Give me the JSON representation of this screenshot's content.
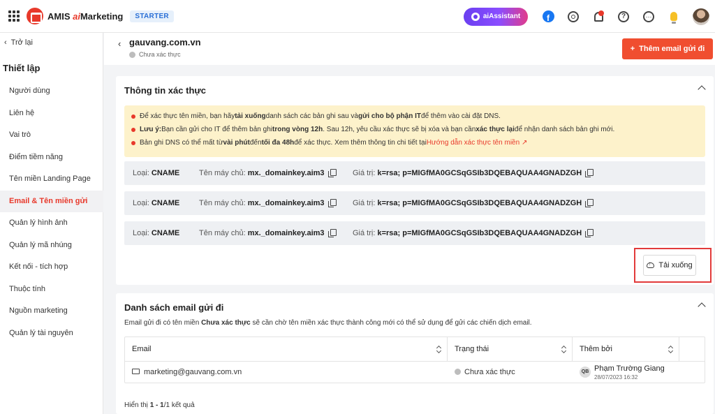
{
  "topbar": {
    "brand_prefix": "AMIS ",
    "brand_ai": "ai",
    "brand_suffix": "Marketing",
    "plan": "STARTER",
    "ai_assistant": "aiAssistant",
    "fb_glyph": "f",
    "help_glyph": "?",
    "more_glyph": "···",
    "icons": [
      "apps-grid-icon",
      "facebook-icon",
      "gear-icon",
      "bell-icon",
      "help-icon",
      "more-icon",
      "lightbulb-icon",
      "user-avatar"
    ],
    "colors": {
      "brand": "#e8392b",
      "plan_badge": "#2a6fd6"
    }
  },
  "sidebar": {
    "back": "Trở lại",
    "back_glyph": "‹",
    "title": "Thiết lập",
    "items": [
      {
        "label": "Người dùng"
      },
      {
        "label": "Liên hệ"
      },
      {
        "label": "Vai trò"
      },
      {
        "label": "Điểm tiềm năng"
      },
      {
        "label": "Tên miền Landing Page"
      },
      {
        "label": "Email & Tên miền gửi"
      },
      {
        "label": "Quản lý hình ảnh"
      },
      {
        "label": "Quản lý mã nhúng"
      },
      {
        "label": "Kết nối - tích hợp"
      },
      {
        "label": "Thuộc tính"
      },
      {
        "label": "Nguồn marketing"
      },
      {
        "label": "Quản lý tài nguyên"
      }
    ],
    "active_index": 5
  },
  "header": {
    "back_glyph": "‹",
    "domain": "gauvang.com.vn",
    "status": "Chưa xác thực",
    "add_button_icon": "+",
    "add_button": "Thêm email gửi đi",
    "add_button_color": "#f04e30"
  },
  "verify": {
    "title": "Thông tin xác thực",
    "notice": {
      "l1_a": "Để xác thực tên miền, bạn hãy ",
      "l1_b": "tải xuống",
      "l1_c": " danh sách các bản ghi sau và ",
      "l1_d": "gửi cho bộ phận IT",
      "l1_e": " để thêm vào cài đặt DNS.",
      "l2_a": "Lưu ý:",
      "l2_b": " Bạn cần gửi cho IT để thêm bản ghi ",
      "l2_c": "trong vòng 12h",
      "l2_d": ". Sau 12h, yêu cầu xác thực sẽ bị xóa và bạn cần ",
      "l2_e": "xác thực lại",
      "l2_f": " để nhận danh sách bản ghi mới.",
      "l3_a": "Bản ghi DNS có thể mất từ ",
      "l3_b": "vài phút",
      "l3_c": " đến ",
      "l3_d": "tối đa 48h",
      "l3_e": " để xác thực. Xem thêm thông tin chi tiết tại ",
      "l3_link": "Hướng dẫn xác thực tên miền",
      "l3_link_icon": "↗"
    },
    "records": [
      {
        "type_label": "Loại:",
        "type": "CNAME",
        "host_label": "Tên máy chủ:",
        "host": "mx._domainkey.aim3",
        "value_label": "Giá trị:",
        "value": "k=rsa; p=MIGfMA0GCSqGSIb3DQEBAQUAA4GNADZGH"
      },
      {
        "type_label": "Loại:",
        "type": "CNAME",
        "host_label": "Tên máy chủ:",
        "host": "mx._domainkey.aim3",
        "value_label": "Giá trị:",
        "value": "k=rsa; p=MIGfMA0GCSqGSIb3DQEBAQUAA4GNADZGH"
      },
      {
        "type_label": "Loại:",
        "type": "CNAME",
        "host_label": "Tên máy chủ:",
        "host": "mx._domainkey.aim3",
        "value_label": "Giá trị:",
        "value": "k=rsa; p=MIGfMA0GCSqGSIb3DQEBAQUAA4GNADZGH"
      }
    ],
    "download": "Tải xuống"
  },
  "senders": {
    "title": "Danh sách email gửi đi",
    "desc_a": "Email gửi đi có tên miền ",
    "desc_b": "Chưa xác thực",
    "desc_c": " sẽ cần chờ tên miền xác thực thành công mới có thể sử dụng để gửi các chiến dịch email.",
    "columns": [
      "Email",
      "Trạng thái",
      "Thêm bởi"
    ],
    "rows": [
      {
        "email": "marketing@gauvang.com.vn",
        "status": "Chưa xác thực",
        "avatar": "QB",
        "name": "Phạm Trường Giang",
        "date": "28/07/2023 16:32"
      }
    ],
    "footer_a": "Hiển thị ",
    "footer_b": "1 - 1",
    "footer_c": "/1 kết quả"
  }
}
